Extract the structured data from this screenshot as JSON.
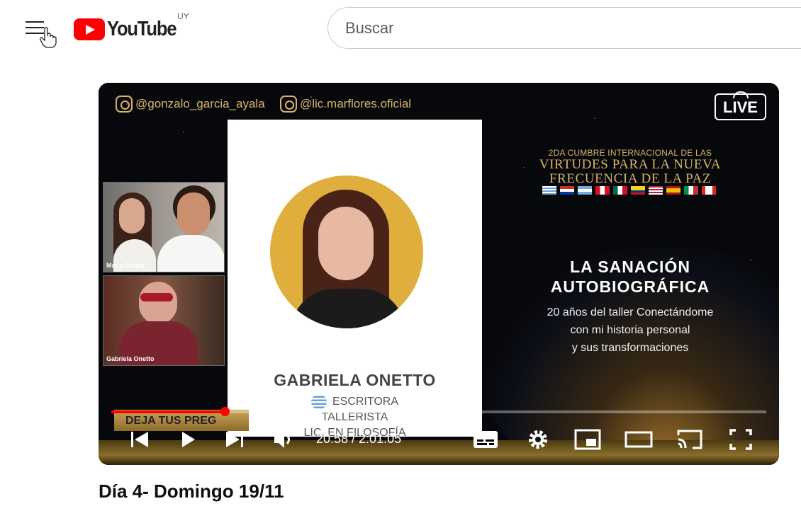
{
  "header": {
    "logo_text": "YouTube",
    "country_code": "UY",
    "search_placeholder": "Buscar"
  },
  "video_content": {
    "instagram_handles": [
      "@gonzalo_garcia_ayala",
      "@lic.marflores.oficial"
    ],
    "live_badge": "LIVE",
    "speaker_name": "GABRIELA ONETTO",
    "speaker_roles": [
      "ESCRITORA",
      "TALLERISTA",
      "LIC. EN FILOSOFÍA"
    ],
    "summit_line1": "2DA CUMBRE INTERNACIONAL DE LAS",
    "summit_line2": "VIRTUDES PARA LA NUEVA",
    "summit_line3": "FRECUENCIA DE LA PAZ",
    "talk_title_line1": "LA SANACIÓN",
    "talk_title_line2": "AUTOBIOGRÁFICA",
    "talk_subtitle_line1": "20 años del taller Conectándome",
    "talk_subtitle_line2": "con mi historia personal",
    "talk_subtitle_line3": "y sus transformaciones",
    "webcam_labels": [
      "Mar y Gonza",
      "Gabriela Onetto"
    ],
    "lower_third_text": "DEJA TUS PREG"
  },
  "player": {
    "current_time": "20:58",
    "duration": "2:01:05",
    "time_display": "20:58 / 2:01:05",
    "progress_fraction": 0.173,
    "accent_color": "#ff0000"
  },
  "video_title": "Día 4- Domingo 19/11"
}
